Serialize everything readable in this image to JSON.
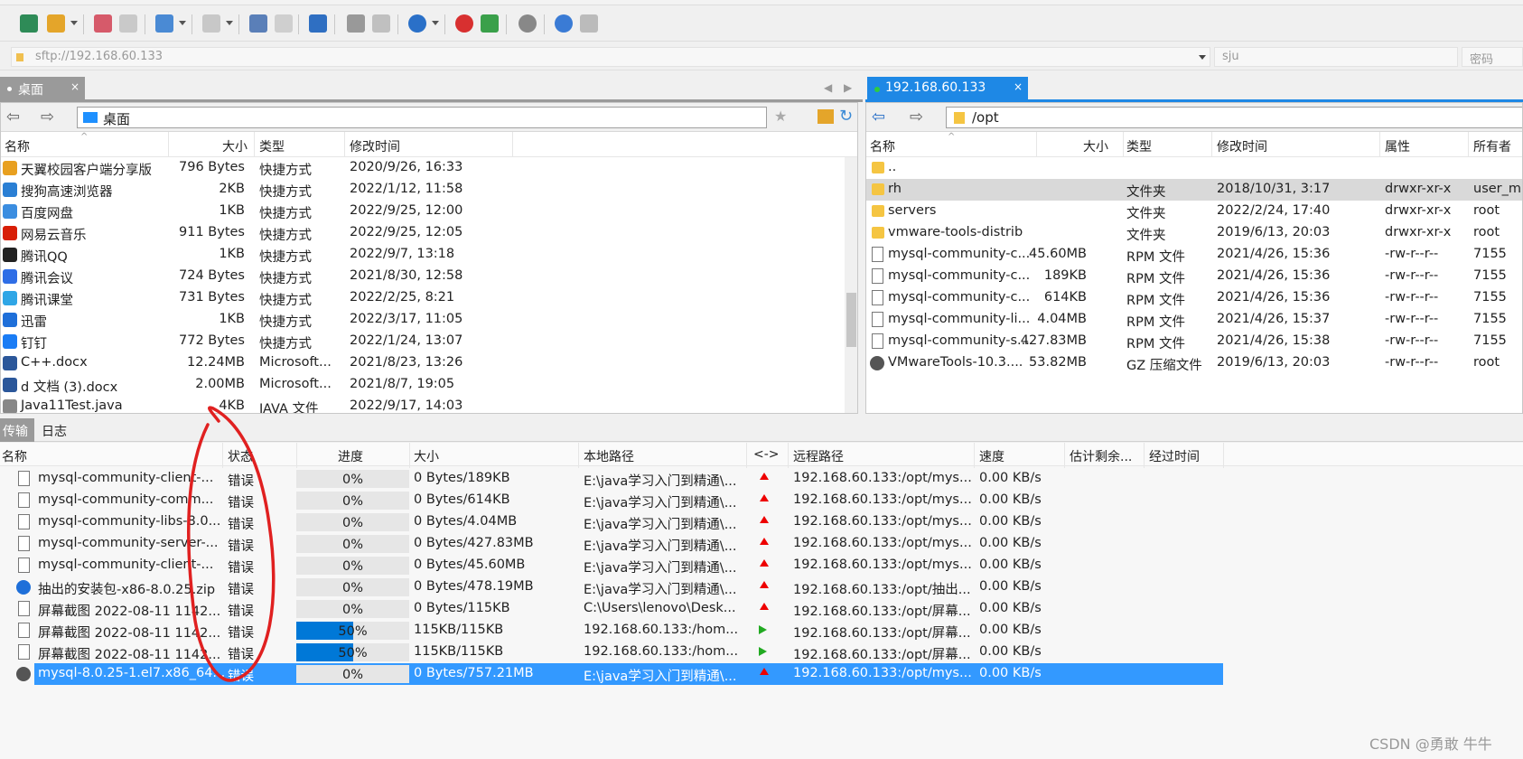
{
  "address": {
    "url": "sftp://192.168.60.133",
    "user": "sju",
    "password_placeholder": "密码"
  },
  "left_tab": {
    "label": "桌面"
  },
  "right_tab": {
    "label": "192.168.60.133"
  },
  "left_path": "桌面",
  "right_path": "/opt",
  "left_headers": {
    "name": "名称",
    "size": "大小",
    "type": "类型",
    "modified": "修改时间"
  },
  "right_headers": {
    "name": "名称",
    "size": "大小",
    "type": "类型",
    "modified": "修改时间",
    "attrs": "属性",
    "owner": "所有者"
  },
  "left_files": [
    {
      "name": "天翼校园客户端分享版",
      "size": "796 Bytes",
      "type": "快捷方式",
      "modified": "2020/9/26, 16:33",
      "color": "#e8a020"
    },
    {
      "name": "搜狗高速浏览器",
      "size": "2KB",
      "type": "快捷方式",
      "modified": "2022/1/12, 11:58",
      "color": "#2a7fd4"
    },
    {
      "name": "百度网盘",
      "size": "1KB",
      "type": "快捷方式",
      "modified": "2022/9/25, 12:00",
      "color": "#3b8de0"
    },
    {
      "name": "网易云音乐",
      "size": "911 Bytes",
      "type": "快捷方式",
      "modified": "2022/9/25, 12:05",
      "color": "#d81e06"
    },
    {
      "name": "腾讯QQ",
      "size": "1KB",
      "type": "快捷方式",
      "modified": "2022/9/7, 13:18",
      "color": "#222222"
    },
    {
      "name": "腾讯会议",
      "size": "724 Bytes",
      "type": "快捷方式",
      "modified": "2021/8/30, 12:58",
      "color": "#2f6ee6"
    },
    {
      "name": "腾讯课堂",
      "size": "731 Bytes",
      "type": "快捷方式",
      "modified": "2022/2/25, 8:21",
      "color": "#2fa6e6"
    },
    {
      "name": "迅雷",
      "size": "1KB",
      "type": "快捷方式",
      "modified": "2022/3/17, 11:05",
      "color": "#1e6fd9"
    },
    {
      "name": "钉钉",
      "size": "772 Bytes",
      "type": "快捷方式",
      "modified": "2022/1/24, 13:07",
      "color": "#1a7cf5"
    },
    {
      "name": "C++.docx",
      "size": "12.24MB",
      "type": "Microsoft...",
      "modified": "2021/8/23, 13:26",
      "color": "#2b579a"
    },
    {
      "name": "d 文档 (3).docx",
      "size": "2.00MB",
      "type": "Microsoft...",
      "modified": "2021/8/7, 19:05",
      "color": "#2b579a"
    },
    {
      "name": "Java11Test.java",
      "size": "4KB",
      "type": "JAVA 文件",
      "modified": "2022/9/17, 14:03",
      "color": "#888888"
    }
  ],
  "right_files": [
    {
      "name": "..",
      "size": "",
      "type": "",
      "modified": "",
      "attrs": "",
      "owner": "",
      "kind": "folder"
    },
    {
      "name": "rh",
      "size": "",
      "type": "文件夹",
      "modified": "2018/10/31, 3:17",
      "attrs": "drwxr-xr-x",
      "owner": "user_m",
      "kind": "folder"
    },
    {
      "name": "servers",
      "size": "",
      "type": "文件夹",
      "modified": "2022/2/24, 17:40",
      "attrs": "drwxr-xr-x",
      "owner": "root",
      "kind": "folder"
    },
    {
      "name": "vmware-tools-distrib",
      "size": "",
      "type": "文件夹",
      "modified": "2019/6/13, 20:03",
      "attrs": "drwxr-xr-x",
      "owner": "root",
      "kind": "folder"
    },
    {
      "name": "mysql-community-c...",
      "size": "45.60MB",
      "type": "RPM 文件",
      "modified": "2021/4/26, 15:36",
      "attrs": "-rw-r--r--",
      "owner": "7155",
      "kind": "file"
    },
    {
      "name": "mysql-community-c...",
      "size": "189KB",
      "type": "RPM 文件",
      "modified": "2021/4/26, 15:36",
      "attrs": "-rw-r--r--",
      "owner": "7155",
      "kind": "file"
    },
    {
      "name": "mysql-community-c...",
      "size": "614KB",
      "type": "RPM 文件",
      "modified": "2021/4/26, 15:36",
      "attrs": "-rw-r--r--",
      "owner": "7155",
      "kind": "file"
    },
    {
      "name": "mysql-community-li...",
      "size": "4.04MB",
      "type": "RPM 文件",
      "modified": "2021/4/26, 15:37",
      "attrs": "-rw-r--r--",
      "owner": "7155",
      "kind": "file"
    },
    {
      "name": "mysql-community-s...",
      "size": "427.83MB",
      "type": "RPM 文件",
      "modified": "2021/4/26, 15:38",
      "attrs": "-rw-r--r--",
      "owner": "7155",
      "kind": "file"
    },
    {
      "name": "VMwareTools-10.3....",
      "size": "53.82MB",
      "type": "GZ 压缩文件",
      "modified": "2019/6/13, 20:03",
      "attrs": "-rw-r--r--",
      "owner": "root",
      "kind": "gz"
    }
  ],
  "bottom_tabs": {
    "transfer": "传输",
    "log": "日志"
  },
  "transfer_headers": {
    "name": "名称",
    "status": "状态",
    "progress": "进度",
    "size": "大小",
    "local": "本地路径",
    "dir": "<->",
    "remote": "远程路径",
    "speed": "速度",
    "eta": "估计剩余...",
    "elapsed": "经过时间"
  },
  "transfers": [
    {
      "name": "mysql-community-client-...",
      "status": "错误",
      "progress": 0,
      "progress_text": "0%",
      "size": "0 Bytes/189KB",
      "local": "E:\\java学习入门到精通\\...",
      "dir": "up",
      "remote": "192.168.60.133:/opt/mys...",
      "speed": "0.00 KB/s"
    },
    {
      "name": "mysql-community-comm...",
      "status": "错误",
      "progress": 0,
      "progress_text": "0%",
      "size": "0 Bytes/614KB",
      "local": "E:\\java学习入门到精通\\...",
      "dir": "up",
      "remote": "192.168.60.133:/opt/mys...",
      "speed": "0.00 KB/s"
    },
    {
      "name": "mysql-community-libs-8.0...",
      "status": "错误",
      "progress": 0,
      "progress_text": "0%",
      "size": "0 Bytes/4.04MB",
      "local": "E:\\java学习入门到精通\\...",
      "dir": "up",
      "remote": "192.168.60.133:/opt/mys...",
      "speed": "0.00 KB/s"
    },
    {
      "name": "mysql-community-server-...",
      "status": "错误",
      "progress": 0,
      "progress_text": "0%",
      "size": "0 Bytes/427.83MB",
      "local": "E:\\java学习入门到精通\\...",
      "dir": "up",
      "remote": "192.168.60.133:/opt/mys...",
      "speed": "0.00 KB/s"
    },
    {
      "name": "mysql-community-client-...",
      "status": "错误",
      "progress": 0,
      "progress_text": "0%",
      "size": "0 Bytes/45.60MB",
      "local": "E:\\java学习入门到精通\\...",
      "dir": "up",
      "remote": "192.168.60.133:/opt/mys...",
      "speed": "0.00 KB/s"
    },
    {
      "name": "抽出的安装包-x86-8.0.25.zip",
      "status": "错误",
      "progress": 0,
      "progress_text": "0%",
      "size": "0 Bytes/478.19MB",
      "local": "E:\\java学习入门到精通\\...",
      "dir": "up",
      "remote": "192.168.60.133:/opt/抽出...",
      "speed": "0.00 KB/s"
    },
    {
      "name": "屏幕截图 2022-08-11 1142...",
      "status": "错误",
      "progress": 0,
      "progress_text": "0%",
      "size": "0 Bytes/115KB",
      "local": "C:\\Users\\lenovo\\Desk...",
      "dir": "up",
      "remote": "192.168.60.133:/opt/屏幕...",
      "speed": "0.00 KB/s"
    },
    {
      "name": "屏幕截图 2022-08-11 1142...",
      "status": "错误",
      "progress": 0.5,
      "progress_text": "50%",
      "size": "115KB/115KB",
      "local": "192.168.60.133:/hom...",
      "dir": "down",
      "remote": "192.168.60.133:/opt/屏幕...",
      "speed": "0.00 KB/s"
    },
    {
      "name": "屏幕截图 2022-08-11 1142...",
      "status": "错误",
      "progress": 0.5,
      "progress_text": "50%",
      "size": "115KB/115KB",
      "local": "192.168.60.133:/hom...",
      "dir": "down",
      "remote": "192.168.60.133:/opt/屏幕...",
      "speed": "0.00 KB/s"
    },
    {
      "name": "mysql-8.0.25-1.el7.x86_64...",
      "status": "错误",
      "progress": 0,
      "progress_text": "0%",
      "size": "0 Bytes/757.21MB",
      "local": "E:\\java学习入门到精通\\...",
      "dir": "up",
      "remote": "192.168.60.133:/opt/mys...",
      "speed": "0.00 KB/s",
      "selected": true
    }
  ],
  "watermark": "CSDN @勇敢 牛牛",
  "colors": {
    "accent": "#0078d7",
    "error_up": "#e00000",
    "down_ok": "#22aa22",
    "annotation": "#e02020"
  }
}
